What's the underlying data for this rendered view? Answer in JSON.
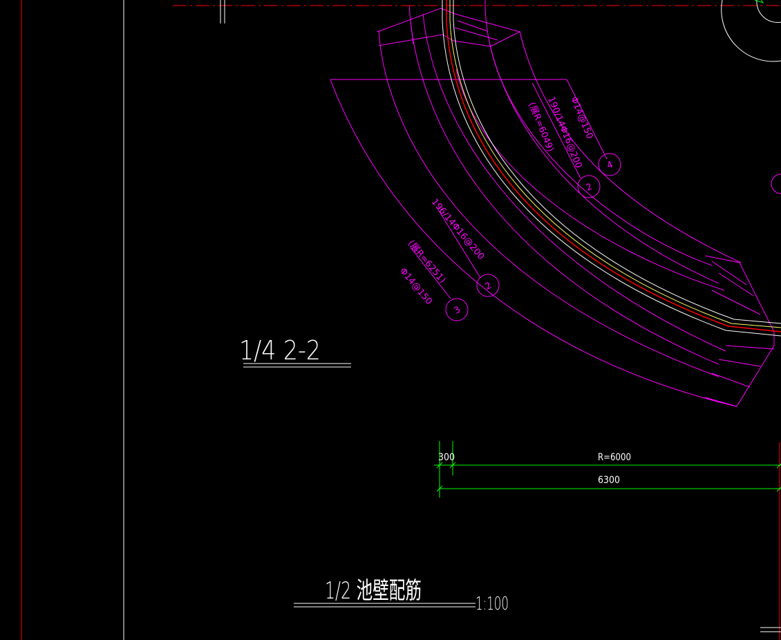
{
  "colors": {
    "background": "#000000",
    "rebar_line": "#ff00ff",
    "dimension": "#00ff00",
    "grid_red": "#ff0000",
    "white": "#ffffff",
    "yellow": "#ffff66"
  },
  "section_title": "1/4  2-2",
  "drawing_title": "1/2 池壁配筋",
  "scale": "1:100",
  "inner_labels": {
    "spacing": "Φ14@150",
    "rebar": "190/14Φ16@200",
    "length": "(展R=6049)",
    "marker_top": "4",
    "marker_bottom": "2"
  },
  "outer_labels": {
    "rebar": "196/14Φ16@200",
    "length": "(展R=6251)",
    "spacing": "Φ14@150",
    "marker_top": "2",
    "marker_bottom": "3"
  },
  "dimensions": {
    "small": "300",
    "radius": "R=6000",
    "total": "6300"
  }
}
